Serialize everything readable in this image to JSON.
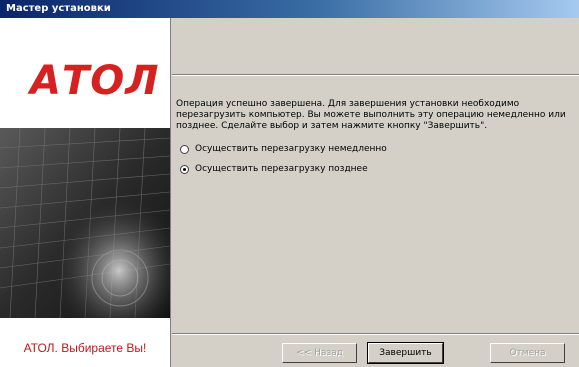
{
  "window": {
    "title": "Мастер установки"
  },
  "brand": {
    "logo_text": "АТОЛ",
    "slogan": "АТОЛ. Выбираете Вы!",
    "accent": "#d72020"
  },
  "message": "Операция успешно завершена. Для завершения установки необходимо перезагрузить компьютер. Вы можете выполнить эту операцию немедленно или позднее. Сделайте выбор и затем нажмите кнопку \"Завершить\".",
  "options": [
    {
      "label": "Осуществить перезагрузку немедленно",
      "selected": false
    },
    {
      "label": "Осуществить перезагрузку позднее",
      "selected": true
    }
  ],
  "buttons": {
    "back": "<< Назад",
    "finish": "Завершить",
    "cancel": "Отмена"
  }
}
